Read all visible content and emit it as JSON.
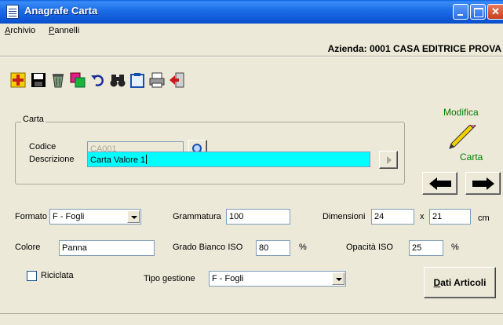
{
  "window": {
    "title": "Anagrafe Carta"
  },
  "menu": [
    {
      "label": "Archivio",
      "mnemonic": "A"
    },
    {
      "label": "Pannelli",
      "mnemonic": "P"
    }
  ],
  "azienda": "Azienda: 0001 CASA EDITRICE PROVA",
  "toolbar": [
    {
      "icon": "add-icon"
    },
    {
      "icon": "save-icon"
    },
    {
      "icon": "delete-icon"
    },
    {
      "icon": "copy-icon"
    },
    {
      "icon": "undo-icon"
    },
    {
      "icon": "binoculars-search-icon"
    },
    {
      "icon": "clipboard-icon"
    },
    {
      "icon": "print-icon"
    },
    {
      "icon": "exit-icon"
    }
  ],
  "carta_group": {
    "title": "Carta",
    "codice_label": "Codice",
    "codice_value": "CA001",
    "descrizione_label": "Descrizione",
    "descrizione_value": "Carta Valore 1"
  },
  "mode": {
    "modifica": "Modifica",
    "carta": "Carta"
  },
  "form": {
    "formato_label": "Formato",
    "formato_value": "F - Fogli",
    "grammatura_label": "Grammatura",
    "grammatura_value": "100",
    "dimensioni_label": "Dimensioni",
    "dim_w": "24",
    "dim_x": "x",
    "dim_h": "21",
    "dim_unit": "cm",
    "colore_label": "Colore",
    "colore_value": "Panna",
    "grado_label": "Grado Bianco ISO",
    "grado_value": "80",
    "grado_unit": "%",
    "opacita_label": "Opacità ISO",
    "opacita_value": "25",
    "opacita_unit": "%",
    "riciclata_label": "Riciclata",
    "riciclata_checked": false,
    "tipo_label": "Tipo gestione",
    "tipo_value": "F - Fogli"
  },
  "dati_articoli": {
    "mnemonic": "D",
    "rest": "ati Articoli"
  },
  "colors": {
    "titlebar": "#0d56d6",
    "highlight_field": "#00ffff",
    "mode_text": "#008000"
  }
}
